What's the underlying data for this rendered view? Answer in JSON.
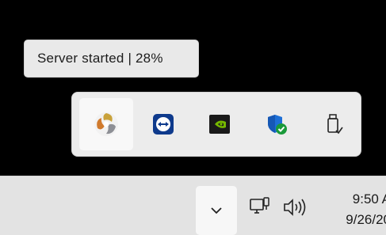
{
  "tooltip": {
    "text": "Server started | 28%"
  },
  "tray_overflow": {
    "icons": [
      {
        "name": "server-app-icon",
        "state": "hovered"
      },
      {
        "name": "teamviewer-icon"
      },
      {
        "name": "nvidia-icon"
      },
      {
        "name": "windows-security-icon"
      },
      {
        "name": "safely-remove-hardware-icon"
      }
    ]
  },
  "taskbar": {
    "overflow_chevron": "chevron-up-icon",
    "system_icons": [
      "network-icon",
      "volume-icon"
    ],
    "clock": {
      "time": "9:50 A",
      "date": "9/26/20"
    }
  },
  "colors": {
    "background": "#000000",
    "flyout": "#ececec",
    "taskbar": "#e3e3e3",
    "nvidia_green": "#76b900",
    "teamviewer_blue": "#0e3a8c",
    "security_blue": "#1d6fd6",
    "check_green": "#1a9a3a"
  }
}
